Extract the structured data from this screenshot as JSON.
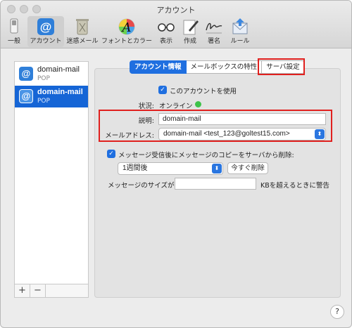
{
  "window": {
    "title": "アカウント"
  },
  "toolbar": {
    "items": [
      {
        "label": "一般",
        "icon": "switch-icon"
      },
      {
        "label": "アカウント",
        "icon": "at-sign-icon"
      },
      {
        "label": "迷惑メール",
        "icon": "trash-junk-icon"
      },
      {
        "label": "フォントとカラー",
        "icon": "font-color-icon"
      },
      {
        "label": "表示",
        "icon": "glasses-icon"
      },
      {
        "label": "作成",
        "icon": "pencil-compose-icon"
      },
      {
        "label": "署名",
        "icon": "signature-icon"
      },
      {
        "label": "ルール",
        "icon": "rules-envelope-icon"
      }
    ]
  },
  "accounts": [
    {
      "name": "domain-mail",
      "type": "POP",
      "selected": false
    },
    {
      "name": "domain-mail",
      "type": "POP",
      "selected": true
    }
  ],
  "list_buttons": {
    "add": "+",
    "remove": "−"
  },
  "tabs": [
    {
      "label": "アカウント情報",
      "active": true
    },
    {
      "label": "メールボックスの特性",
      "active": false
    },
    {
      "label": "サーバ設定",
      "active": false
    }
  ],
  "account_info": {
    "enable_label": "このアカウントを使用",
    "status_label": "状況:",
    "status_value": "オンライン",
    "description_label": "説明:",
    "description_value": "domain-mail",
    "email_label": "メールアドレス:",
    "email_value": "domain-mail <test_123@goltest15.com>",
    "remove_copy_label": "メッセージ受信後にメッセージのコピーをサーバから削除:",
    "remove_after_value": "1週間後",
    "remove_now_button": "今すぐ削除",
    "size_prefix": "メッセージのサイズが",
    "size_value": "",
    "size_suffix": "KBを超えるときに警告"
  },
  "help": {
    "label": "?"
  },
  "colors": {
    "accent": "#1f6fe0",
    "highlight": "#e0201e",
    "status_online": "#3ec24a"
  }
}
